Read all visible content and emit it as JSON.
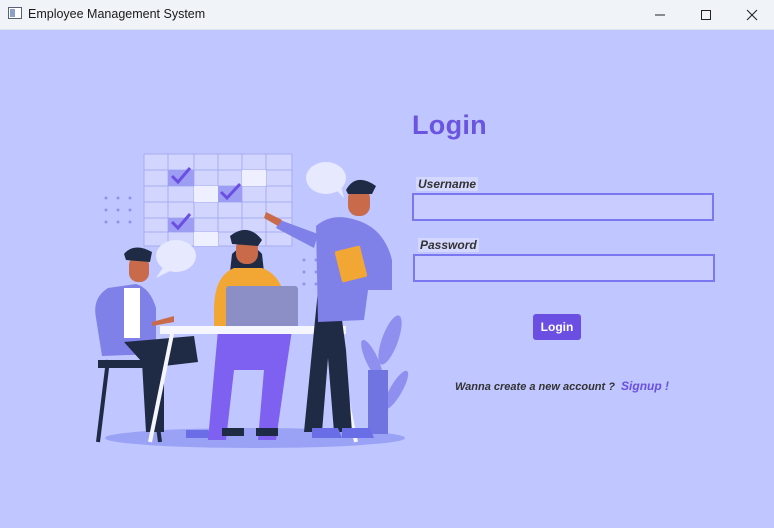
{
  "window": {
    "title": "Employee Management System",
    "icons": [
      "app-icon",
      "minimize-icon",
      "maximize-icon",
      "close-icon"
    ]
  },
  "login": {
    "title": "Login",
    "username_label": "Username",
    "username_value": "",
    "password_label": "Password",
    "password_value": "",
    "login_button": "Login",
    "signup_prompt": "Wanna create a new account ?",
    "signup_link": "Signup !"
  },
  "colors": {
    "background": "#c0c6ff",
    "accent": "#6a4fe2",
    "field_border": "#7a77f0"
  }
}
